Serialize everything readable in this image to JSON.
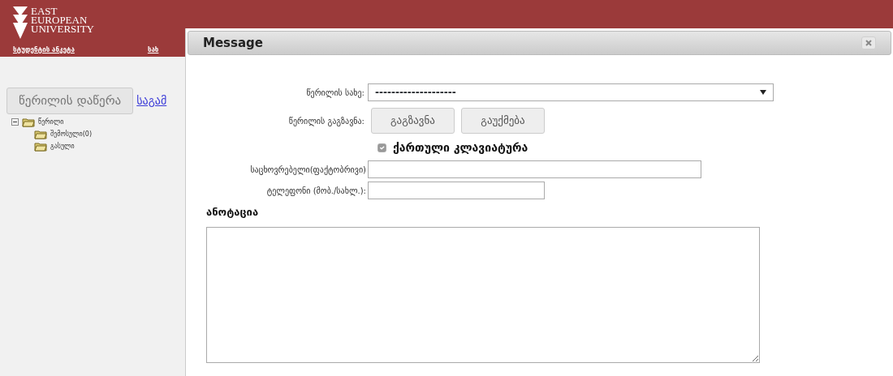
{
  "header": {
    "logo_lines": [
      "EAST",
      "EUROPEAN",
      "UNIVERSITY"
    ],
    "nav": [
      "სტუდენტის ანკეტა",
      "სახ"
    ]
  },
  "sidebar": {
    "compose_button": "წერილის დაწერა",
    "link": "საგამ",
    "tree": [
      {
        "label": "წერილი",
        "expanded": true,
        "children": [
          {
            "label": "შემოსული(0)"
          },
          {
            "label": "გასული"
          }
        ]
      }
    ]
  },
  "dialog": {
    "title": "Message",
    "type_label": "წერილის სახე:",
    "type_value": "--------------------",
    "send_label": "წერილის გაგზავნა:",
    "buttons": [
      "გაგზავნა",
      "გაუქმება"
    ],
    "keyboard": {
      "label": "ქართული კლავიატურა",
      "checked": true
    },
    "fields": [
      {
        "label": "საცხოვრებელი(ფაქტობრივი)",
        "kind": "wide"
      },
      {
        "label": "ტელეფონი (მობ./სახლ.):",
        "kind": "short"
      }
    ],
    "annotation_label": "ანოტაცია"
  }
}
